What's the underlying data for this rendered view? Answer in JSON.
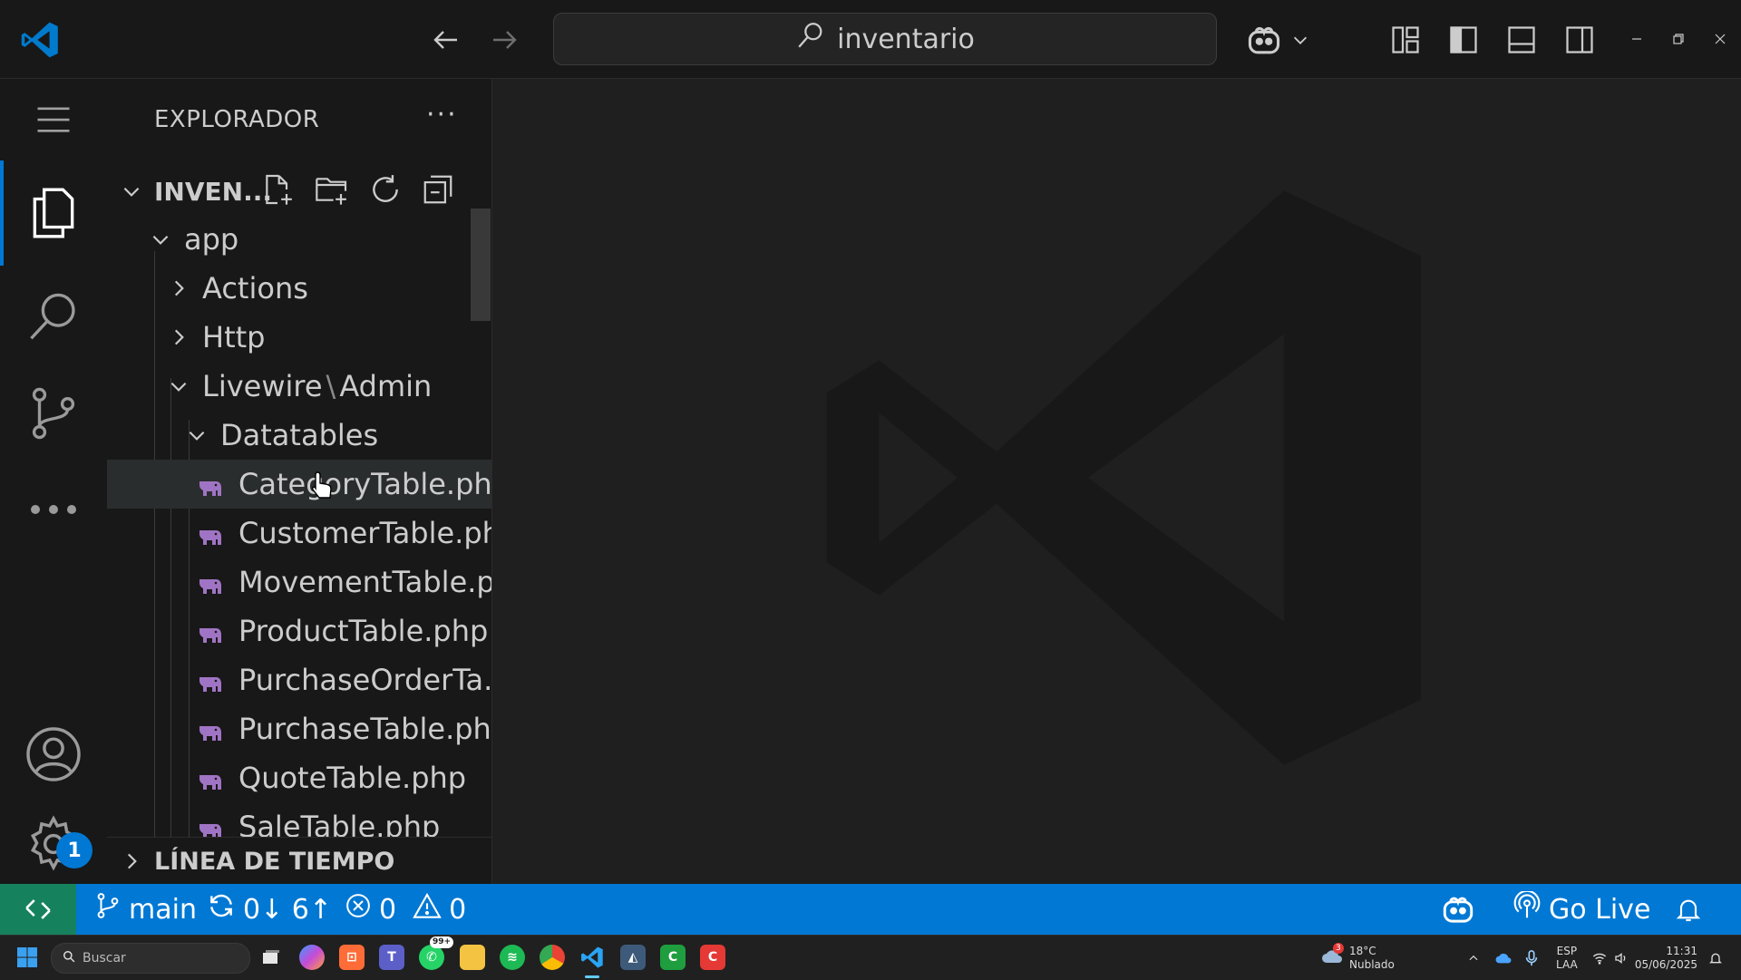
{
  "titlebar": {
    "search_text": "inventario"
  },
  "sidebar": {
    "title": "EXPLORADOR",
    "more": "···",
    "section_title": "INVEN...",
    "timeline_title": "LÍNEA DE TIEMPO",
    "tree": [
      {
        "label": "app"
      },
      {
        "label": "Actions"
      },
      {
        "label": "Http"
      },
      {
        "label": "Livewire",
        "suffix": "Admin"
      },
      {
        "label": "Datatables"
      },
      {
        "label": "CategoryTable.php"
      },
      {
        "label": "CustomerTable.php"
      },
      {
        "label": "MovementTable.p..."
      },
      {
        "label": "ProductTable.php"
      },
      {
        "label": "PurchaseOrderTa..."
      },
      {
        "label": "PurchaseTable.php"
      },
      {
        "label": "QuoteTable.php"
      },
      {
        "label": "SaleTable.php"
      }
    ]
  },
  "activitybar": {
    "settings_badge": "1"
  },
  "statusbar": {
    "branch": "main",
    "sync": "0↓ 6↑",
    "errors": "0",
    "warnings": "0",
    "go_live": "Go Live"
  },
  "taskbar": {
    "search_placeholder": "Buscar",
    "weather_temp": "18°C",
    "weather_desc": "Nublado",
    "weather_badge": "3",
    "whatsapp_badge": "99+",
    "lang": "ESP",
    "layout": "LAA",
    "time": "11:31",
    "date": "05/06/2025"
  },
  "colors": {
    "accent": "#0078d4",
    "remote": "#16825d",
    "php_icon": "#a074c4"
  }
}
